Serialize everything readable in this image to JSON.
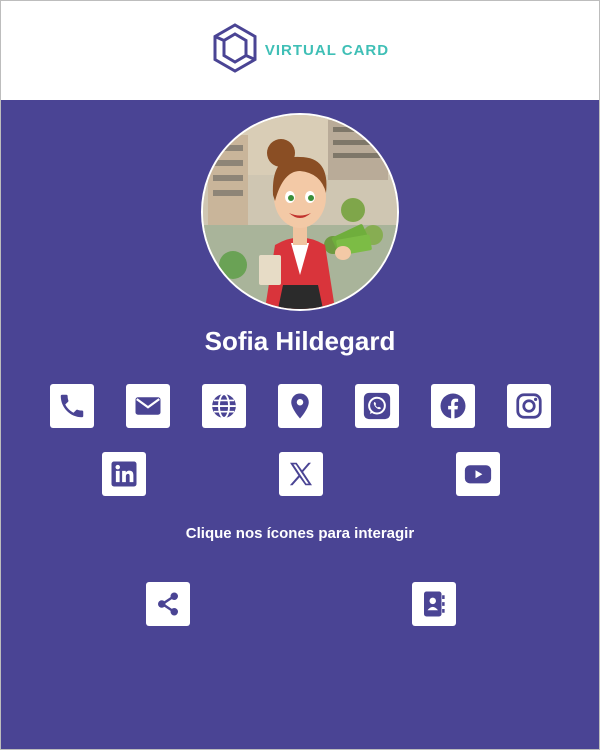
{
  "header": {
    "brand_text": "VIRTUAL CARD",
    "logo_icon": "hexagon-cube-icon",
    "colors": {
      "logo_hexagon": "#4a4494",
      "logo_text": "#3fbfb6"
    }
  },
  "profile": {
    "name": "Sofia Hildegard",
    "avatar": "cartoon-businesswoman-avatar"
  },
  "contact_icons": [
    {
      "icon": "phone-icon"
    },
    {
      "icon": "email-icon"
    },
    {
      "icon": "globe-icon"
    },
    {
      "icon": "location-pin-icon"
    },
    {
      "icon": "whatsapp-icon"
    },
    {
      "icon": "facebook-icon"
    },
    {
      "icon": "instagram-icon"
    },
    {
      "icon": "linkedin-icon"
    },
    {
      "icon": "x-icon"
    },
    {
      "icon": "youtube-icon"
    }
  ],
  "hint_text": "Clique nos ícones para interagir",
  "actions": [
    {
      "icon": "share-icon"
    },
    {
      "icon": "contact-book-icon"
    }
  ],
  "colors": {
    "background": "#4a4494",
    "header_bg": "#ffffff",
    "icon_bg": "#ffffff",
    "icon_fg": "#4a4494",
    "text": "#ffffff"
  }
}
